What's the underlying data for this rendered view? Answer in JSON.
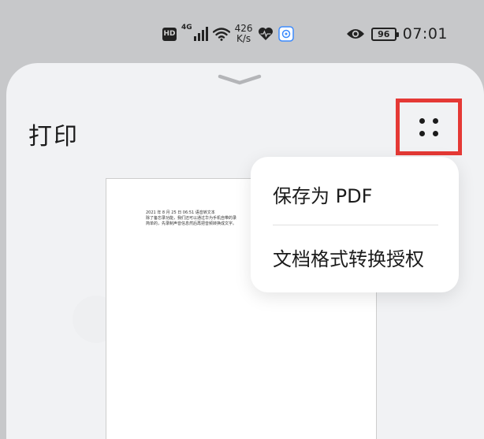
{
  "status_bar": {
    "hd_label": "HD",
    "network_label": "4G",
    "speed_value": "426",
    "speed_unit": "K/s",
    "battery_level": "96",
    "time": "07:01"
  },
  "sheet": {
    "title": "打印"
  },
  "preview": {
    "lines": [
      "2021 年 8 月 25 日  06:51  语音转文本",
      "除了备忘录功能，我们还可以通过华为手机自带的录",
      "简单的，先录制声音信息然后再把音频转换成文字。"
    ]
  },
  "menu": {
    "items": [
      {
        "label": "保存为 PDF"
      },
      {
        "label": "文档格式转换授权"
      }
    ]
  },
  "colors": {
    "highlight_border": "#e53935",
    "sheet_background": "#f1f2f4",
    "backdrop": "#c7c8ca"
  },
  "icons": [
    "signal-icon",
    "wifi-icon",
    "heart-icon",
    "app-icon",
    "eye-icon",
    "battery-icon",
    "chevron-down-icon",
    "more-dots-icon"
  ]
}
